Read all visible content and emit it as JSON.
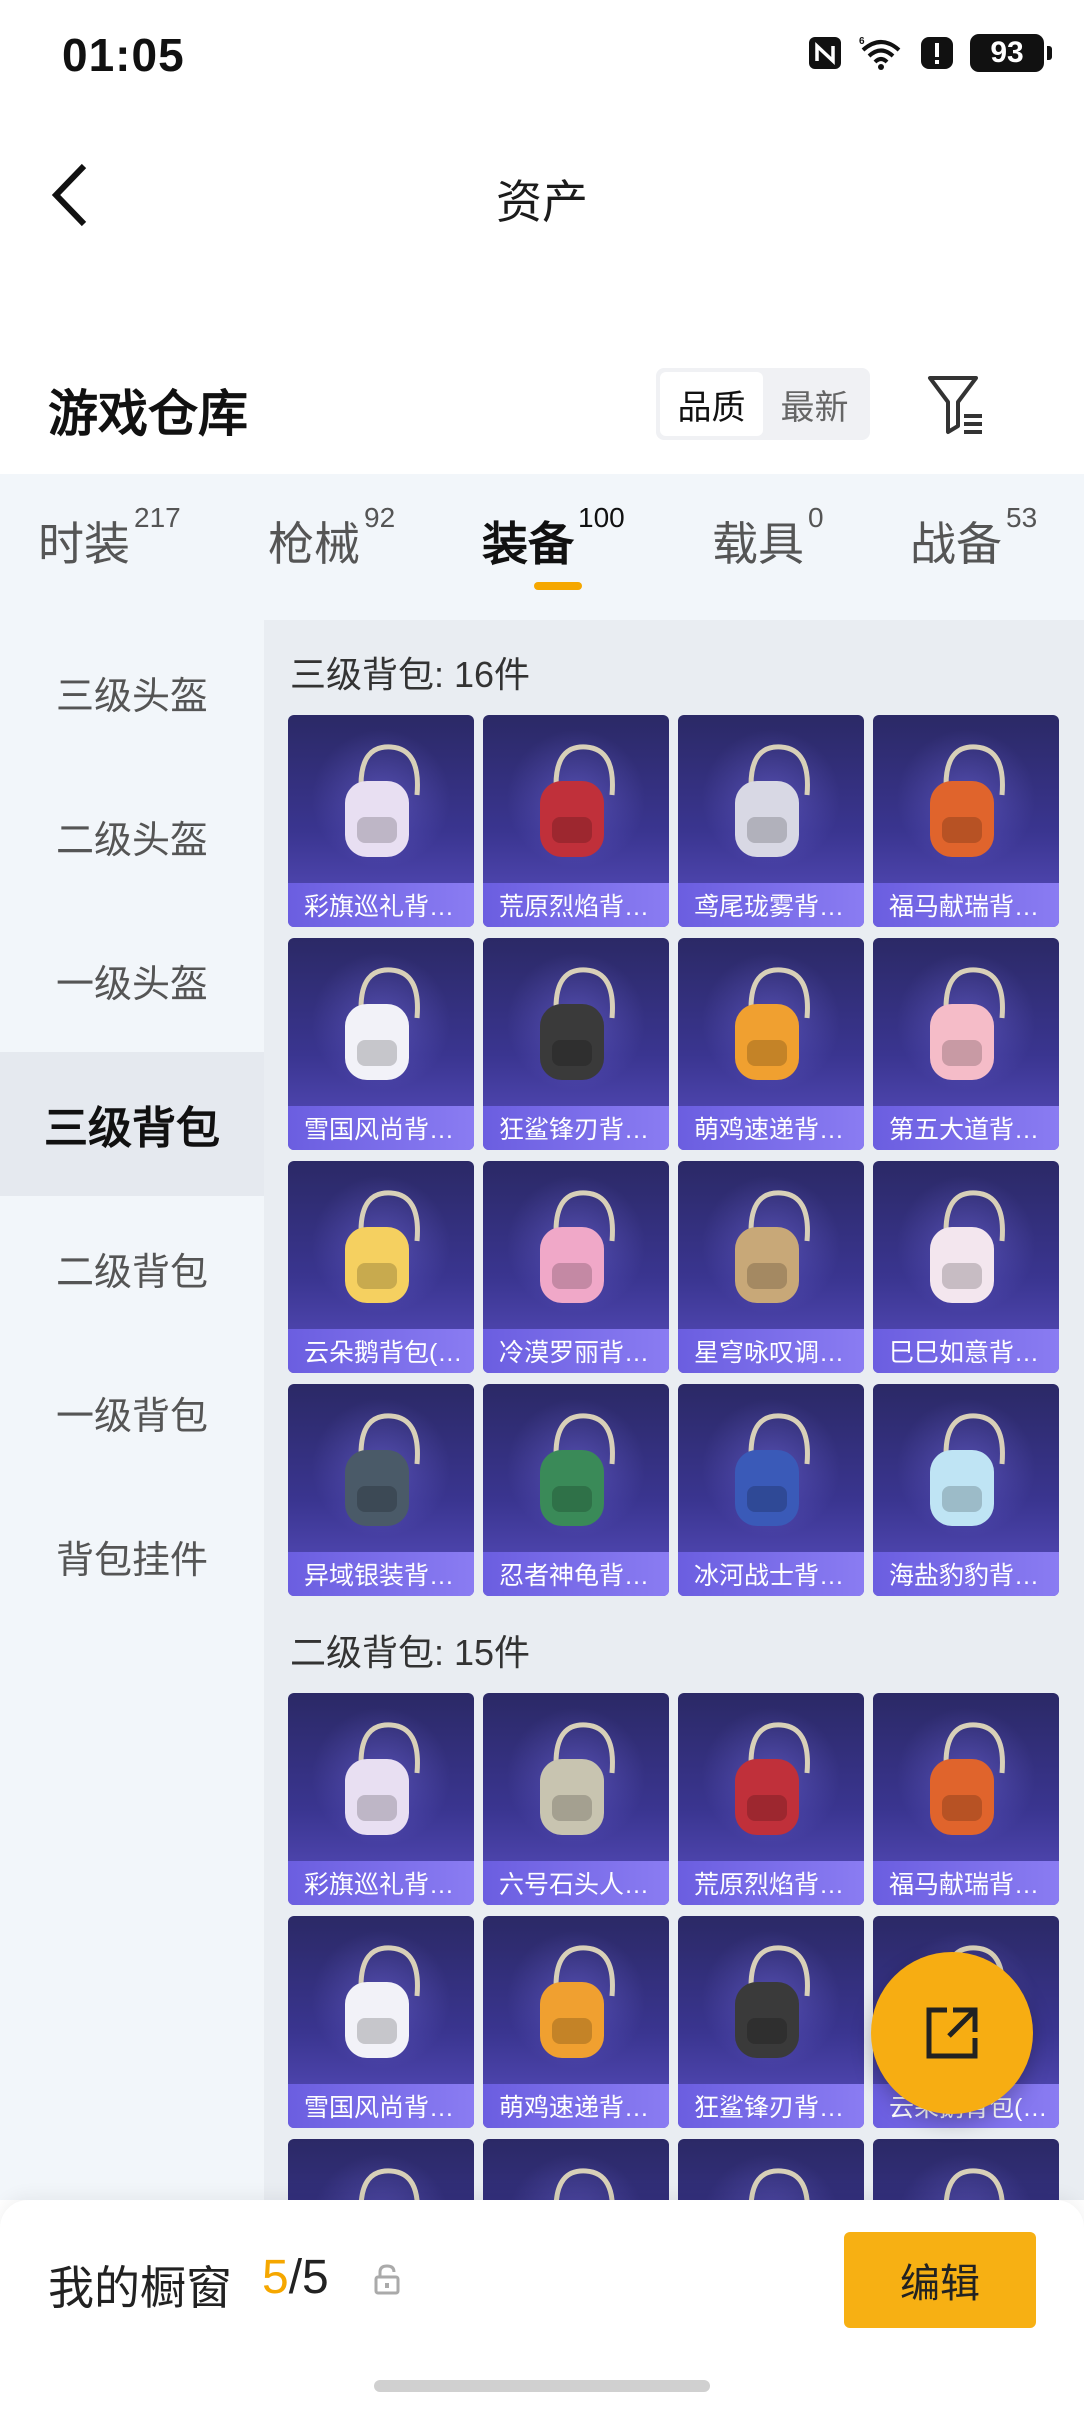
{
  "status_bar": {
    "time": "01:05",
    "battery": "93",
    "icons": [
      "nfc-icon",
      "wifi-icon",
      "alert-icon",
      "battery-icon"
    ]
  },
  "header": {
    "title": "资产"
  },
  "section": {
    "title": "游戏仓库",
    "sort_options": [
      "品质",
      "最新"
    ],
    "sort_active": "品质"
  },
  "category_tabs": [
    {
      "label": "时装",
      "count": "217",
      "active": false
    },
    {
      "label": "枪械",
      "count": "92",
      "active": false
    },
    {
      "label": "装备",
      "count": "100",
      "active": true
    },
    {
      "label": "载具",
      "count": "0",
      "active": false
    },
    {
      "label": "战备",
      "count": "53",
      "active": false
    }
  ],
  "sidebar": {
    "items": [
      {
        "label": "三级头盔",
        "active": false
      },
      {
        "label": "二级头盔",
        "active": false
      },
      {
        "label": "一级头盔",
        "active": false
      },
      {
        "label": "三级背包",
        "active": true
      },
      {
        "label": "二级背包",
        "active": false
      },
      {
        "label": "一级背包",
        "active": false
      },
      {
        "label": "背包挂件",
        "active": false
      }
    ]
  },
  "groups": [
    {
      "title": "三级背包: 16件",
      "items": [
        {
          "name": "彩旗巡礼背…",
          "color": "#e8dff2"
        },
        {
          "name": "荒原烈焰背…",
          "color": "#c0303a"
        },
        {
          "name": "鸢尾珑雾背…",
          "color": "#d8d8e4"
        },
        {
          "name": "福马献瑞背…",
          "color": "#e0642c"
        },
        {
          "name": "雪国风尚背…",
          "color": "#f2f2f8"
        },
        {
          "name": "狂鲨锋刃背…",
          "color": "#3a3a3a"
        },
        {
          "name": "萌鸡速递背…",
          "color": "#f0a030"
        },
        {
          "name": "第五大道背…",
          "color": "#f5bcc8"
        },
        {
          "name": "云朵鹅背包(…",
          "color": "#f5d060"
        },
        {
          "name": "冷漠罗丽背…",
          "color": "#f0a8c8"
        },
        {
          "name": "星穹咏叹调…",
          "color": "#c8a878"
        },
        {
          "name": "巳巳如意背…",
          "color": "#f3e6ee"
        },
        {
          "name": "异域银装背…",
          "color": "#4a5a68"
        },
        {
          "name": "忍者神龟背…",
          "color": "#3a8a58"
        },
        {
          "name": "冰河战士背…",
          "color": "#3a5ab8"
        },
        {
          "name": "海盐豹豹背…",
          "color": "#bfe4f4"
        }
      ]
    },
    {
      "title": "二级背包: 15件",
      "items": [
        {
          "name": "彩旗巡礼背…",
          "color": "#e8dff2"
        },
        {
          "name": "六号石头人…",
          "color": "#c8c4b0"
        },
        {
          "name": "荒原烈焰背…",
          "color": "#c0303a"
        },
        {
          "name": "福马献瑞背…",
          "color": "#e0642c"
        },
        {
          "name": "雪国风尚背…",
          "color": "#f2f2f8"
        },
        {
          "name": "萌鸡速递背…",
          "color": "#f0a030"
        },
        {
          "name": "狂鲨锋刃背…",
          "color": "#3a3a3a"
        },
        {
          "name": "云朵鹅背包(…",
          "color": "#f5d060"
        },
        {
          "name": "",
          "color": "#3a3a3a"
        },
        {
          "name": "",
          "color": "#3a8a58"
        },
        {
          "name": "",
          "color": "#c0303a"
        },
        {
          "name": "",
          "color": "#3a5ab8"
        }
      ]
    }
  ],
  "bottom_bar": {
    "label": "我的橱窗",
    "count_current": "5",
    "count_total": "/5",
    "edit_label": "编辑"
  },
  "colors": {
    "accent": "#f5a700",
    "card_top": "#2b2966",
    "card_label": "#7a6df0"
  }
}
